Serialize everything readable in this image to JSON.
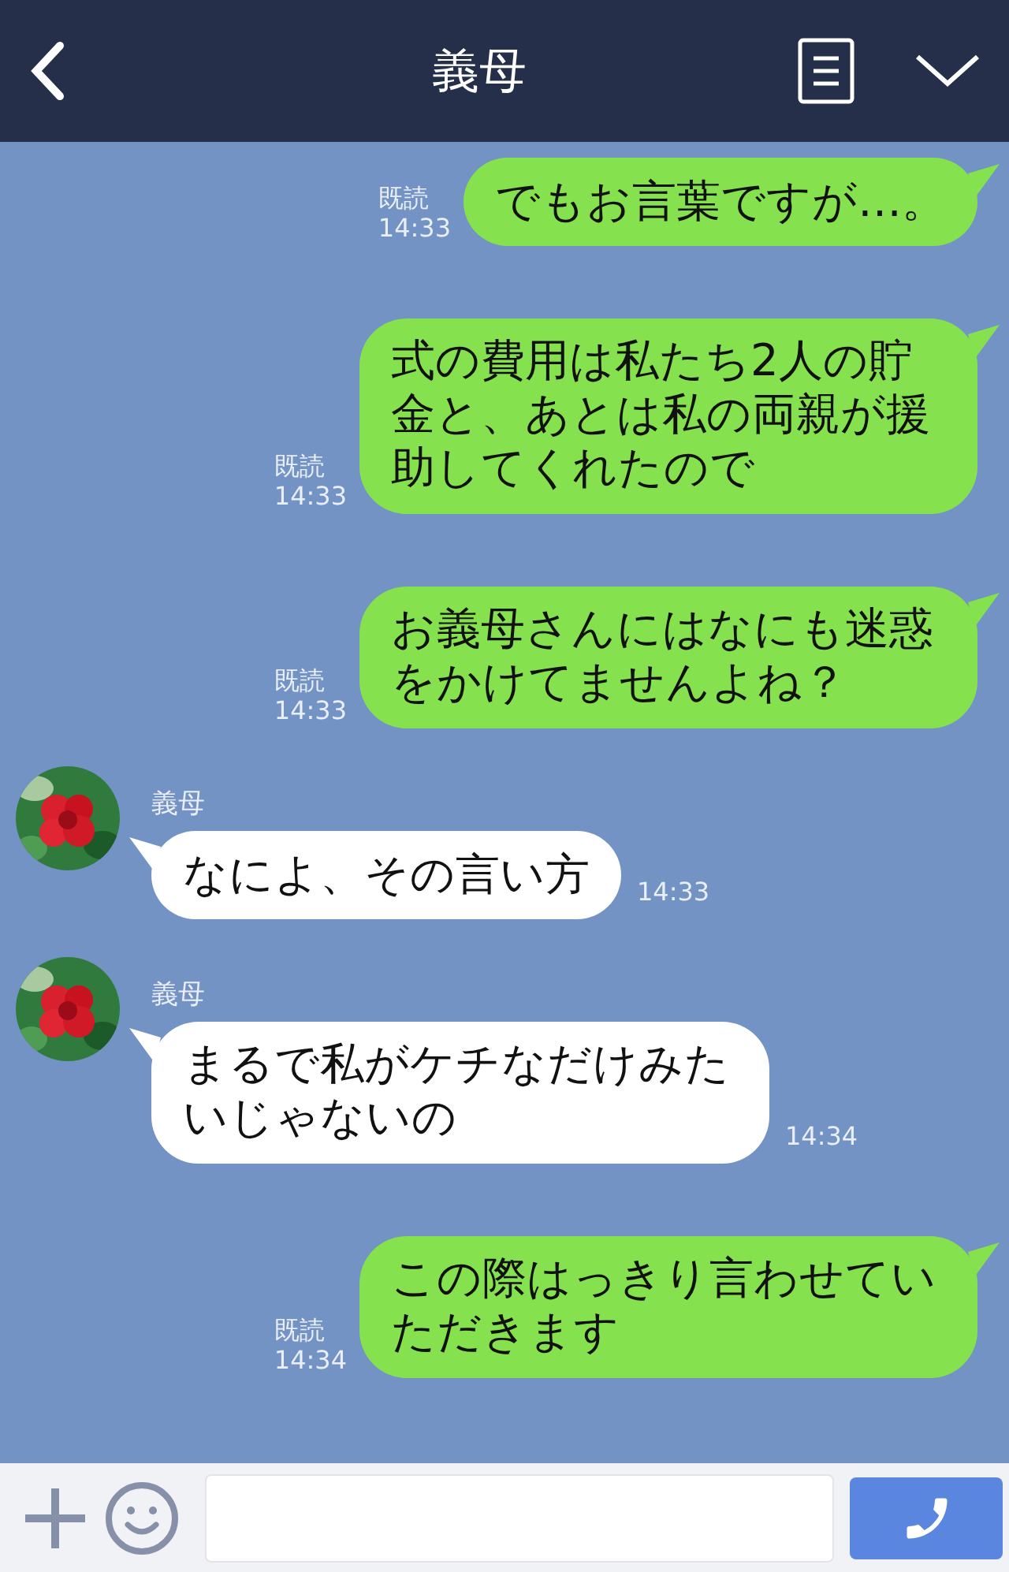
{
  "header": {
    "title": "義母"
  },
  "messages": [
    {
      "kind": "sent",
      "text": "でもお言葉ですが…。",
      "read": "既読",
      "time": "14:33"
    },
    {
      "kind": "sent",
      "text": "式の費用は私たち2人の貯金と、あとは私の両親が援助してくれたので",
      "read": "既読",
      "time": "14:33"
    },
    {
      "kind": "sent",
      "text": "お義母さんにはなにも迷惑をかけてませんよね？",
      "read": "既読",
      "time": "14:33"
    },
    {
      "kind": "received",
      "sender": "義母",
      "text": "なによ、その言い方",
      "time": "14:33"
    },
    {
      "kind": "received",
      "sender": "義母",
      "text": "まるで私がケチなだけみたいじゃないの",
      "time": "14:34"
    },
    {
      "kind": "sent",
      "text": "この際はっきり言わせていただきます",
      "read": "既読",
      "time": "14:34"
    }
  ]
}
